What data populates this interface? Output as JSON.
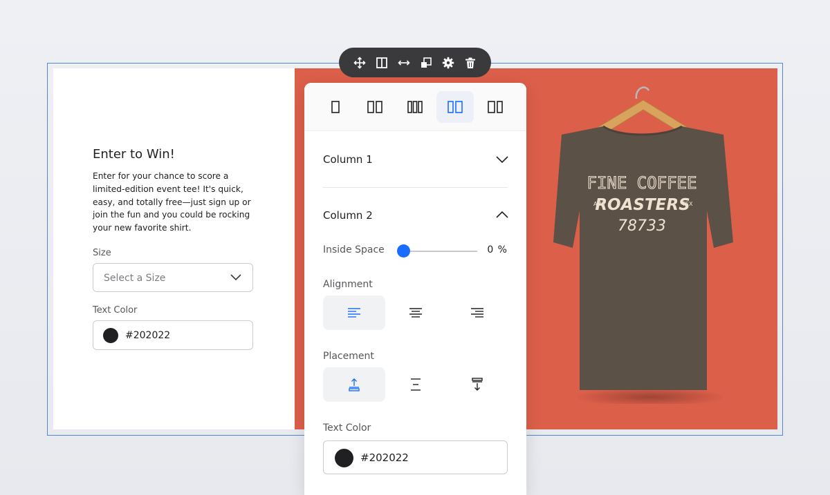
{
  "form": {
    "title": "Enter to Win!",
    "description": "Enter for your chance to score a limited-edition event tee! It's quick, easy, and totally free—just sign up or join the fun and you could be rocking your new favorite shirt.",
    "size_label": "Size",
    "size_placeholder": "Select a Size",
    "text_color_label": "Text Color",
    "text_color_value": "#202022"
  },
  "toolbar": {
    "icons": [
      "move-icon",
      "columns-icon",
      "resize-icon",
      "duplicate-icon",
      "gear-icon",
      "trash-icon"
    ]
  },
  "panel": {
    "layouts": [
      "one-column",
      "two-columns",
      "three-columns",
      "two-columns-narrow-wide",
      "two-columns-wide-narrow"
    ],
    "selected_layout": "two-columns-narrow-wide",
    "column1_label": "Column 1",
    "column2_label": "Column 2",
    "inside_space_label": "Inside Space",
    "inside_space_value": "0 %",
    "alignment_label": "Alignment",
    "alignment_selected": "left",
    "placement_label": "Placement",
    "placement_selected": "top",
    "text_color_label": "Text Color",
    "text_color_value": "#202022"
  },
  "shirt": {
    "line1": "FINE COFFEE",
    "line2_left": "AUS",
    "line2": "ROASTERS",
    "line2_right": "TEX",
    "line3": "78733"
  },
  "colors": {
    "accent": "#1a6cff",
    "frame": "#4f86d9",
    "background_right": "#dc5f4a",
    "toolbar": "#3a3a3d",
    "text": "#202022",
    "shirt": "#5b5147"
  }
}
